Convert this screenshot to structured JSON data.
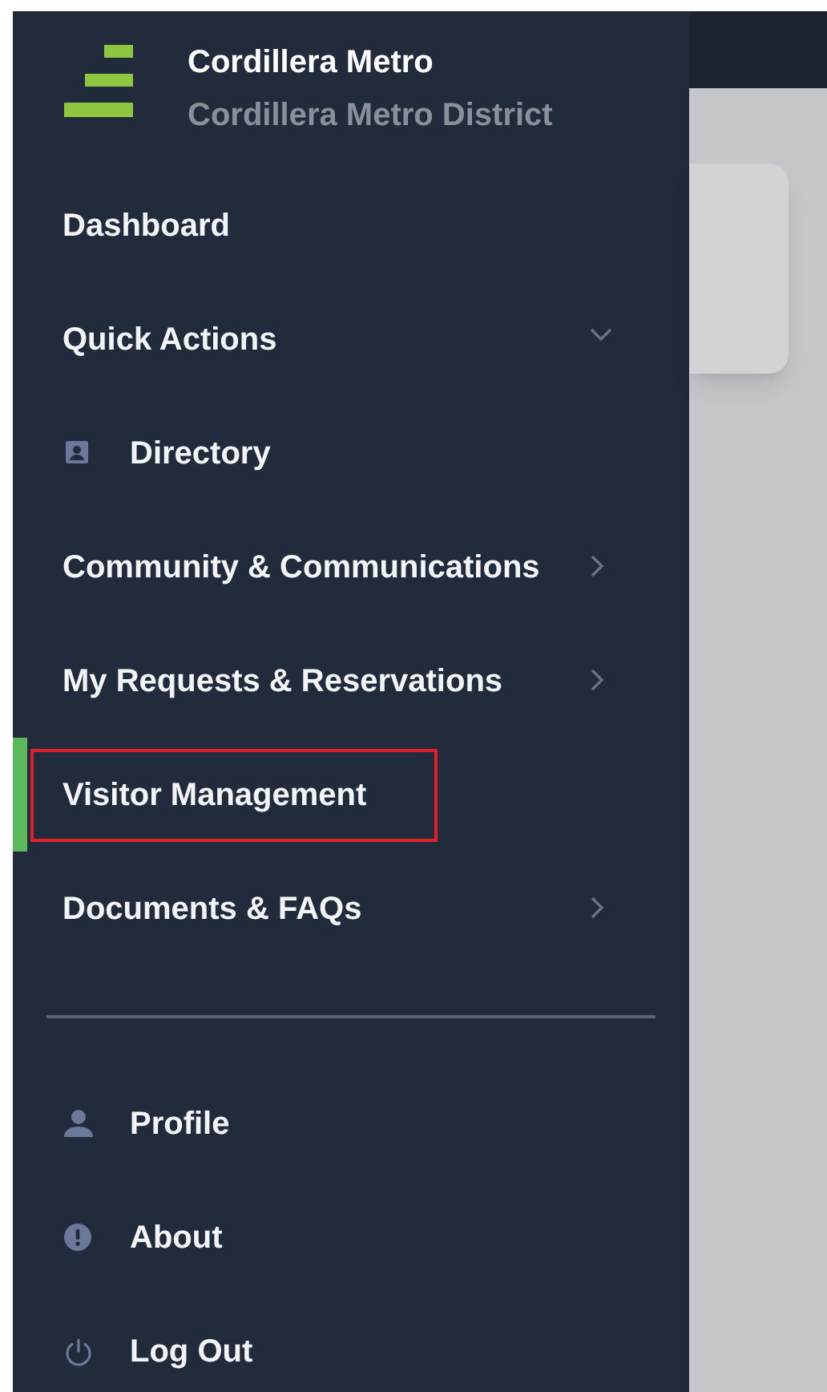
{
  "brand": {
    "title": "Cordillera Metro",
    "subtitle": "Cordillera Metro District"
  },
  "nav": [
    {
      "label": "Dashboard",
      "kind": "plain",
      "selected": false,
      "highlighted": false
    },
    {
      "label": "Quick Actions",
      "kind": "group",
      "expanded": true,
      "selected": false,
      "highlighted": false
    },
    {
      "label": "Directory",
      "kind": "contact",
      "selected": false,
      "highlighted": false
    },
    {
      "label": "Community & Communications",
      "kind": "group",
      "expanded": false,
      "selected": false,
      "highlighted": false
    },
    {
      "label": "My Requests & Reservations",
      "kind": "group",
      "expanded": false,
      "selected": false,
      "highlighted": false
    },
    {
      "label": "Visitor Management",
      "kind": "plain",
      "selected": true,
      "highlighted": true
    },
    {
      "label": "Documents & FAQs",
      "kind": "group",
      "expanded": false,
      "selected": false,
      "highlighted": false
    }
  ],
  "footer": [
    {
      "label": "Profile",
      "kind": "profile"
    },
    {
      "label": "About",
      "kind": "about"
    },
    {
      "label": "Log Out",
      "kind": "logout"
    }
  ]
}
